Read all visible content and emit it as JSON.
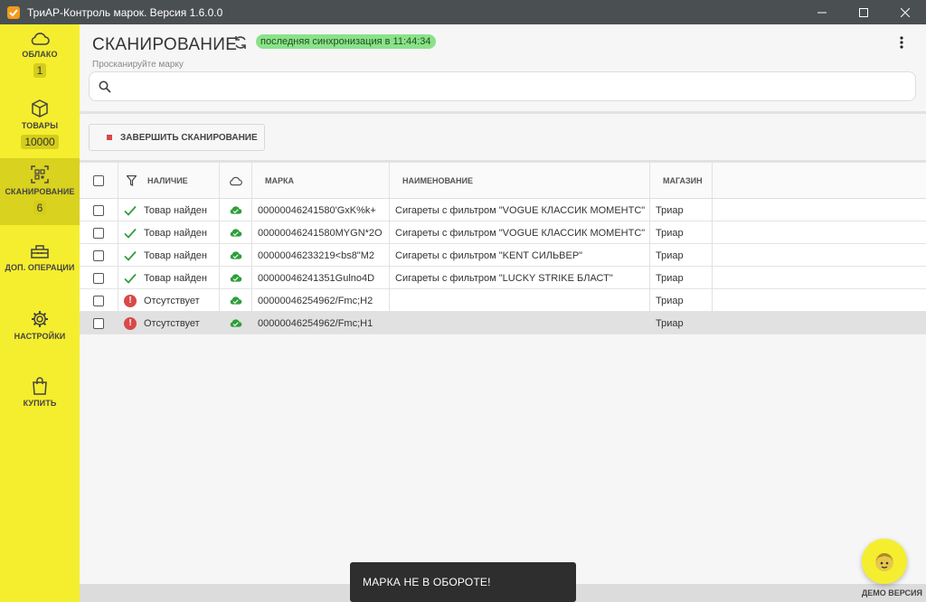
{
  "window": {
    "title": "ТриАР-Контроль марок. Версия 1.6.0.0"
  },
  "sidebar": {
    "items": [
      {
        "label": "ОБЛАКО",
        "count": "1",
        "icon": "cloud-icon"
      },
      {
        "label": "ТОВАРЫ",
        "count": "10000",
        "icon": "box-icon"
      },
      {
        "label": "СКАНИРОВАНИЕ",
        "count": "6",
        "icon": "qr-scan-icon"
      },
      {
        "label": "ДОП. ОПЕРАЦИИ",
        "icon": "toolbox-icon"
      },
      {
        "label": "НАСТРОЙКИ",
        "icon": "gear-icon"
      },
      {
        "label": "КУПИТЬ",
        "icon": "shopping-bag-icon"
      }
    ]
  },
  "header": {
    "title": "СКАНИРОВАНИЕ",
    "sync_badge": "последняя синхронизация в 11:44:34",
    "search_label": "Просканируйте марку",
    "finish_button": "ЗАВЕРШИТЬ СКАНИРОВАНИЕ"
  },
  "table": {
    "columns": [
      "",
      "НАЛИЧИЕ",
      "",
      "МАРКА",
      "НАИМЕНОВАНИЕ",
      "МАГАЗИН"
    ],
    "rows": [
      {
        "status": "Товар найден",
        "ok": true,
        "mark": "00000046241580'GxK%k+",
        "name": "Сигареты с фильтром \"VOGUE КЛАССИК МОМЕНТС\"",
        "store": "Триар"
      },
      {
        "status": "Товар найден",
        "ok": true,
        "mark": "00000046241580MYGN*2O",
        "name": "Сигареты с фильтром \"VOGUE КЛАССИК МОМЕНТС\"",
        "store": "Триар"
      },
      {
        "status": "Товар найден",
        "ok": true,
        "mark": "00000046233219<bs8\"M2",
        "name": "Сигареты с фильтром \"KENT СИЛЬВЕР\"",
        "store": "Триар"
      },
      {
        "status": "Товар найден",
        "ok": true,
        "mark": "00000046241351Gulno4D",
        "name": "Сигареты с фильтром \"LUCKY STRIKE БЛАСТ\"",
        "store": "Триар"
      },
      {
        "status": "Отсутствует",
        "ok": false,
        "mark": "00000046254962/Fmc;H2",
        "name": "",
        "store": "Триар"
      },
      {
        "status": "Отсутствует",
        "ok": false,
        "mark": "00000046254962/Fmc;H1",
        "name": "",
        "store": "Триар"
      }
    ]
  },
  "toast": "МАРКА НЕ В ОБОРОТЕ!",
  "footer": {
    "demo": "ДЕМО ВЕРСИЯ"
  },
  "colors": {
    "sidebar": "#f5ee2e",
    "sync": "#8ae28a",
    "ok": "#2e9e3a",
    "error": "#d84a4a"
  }
}
